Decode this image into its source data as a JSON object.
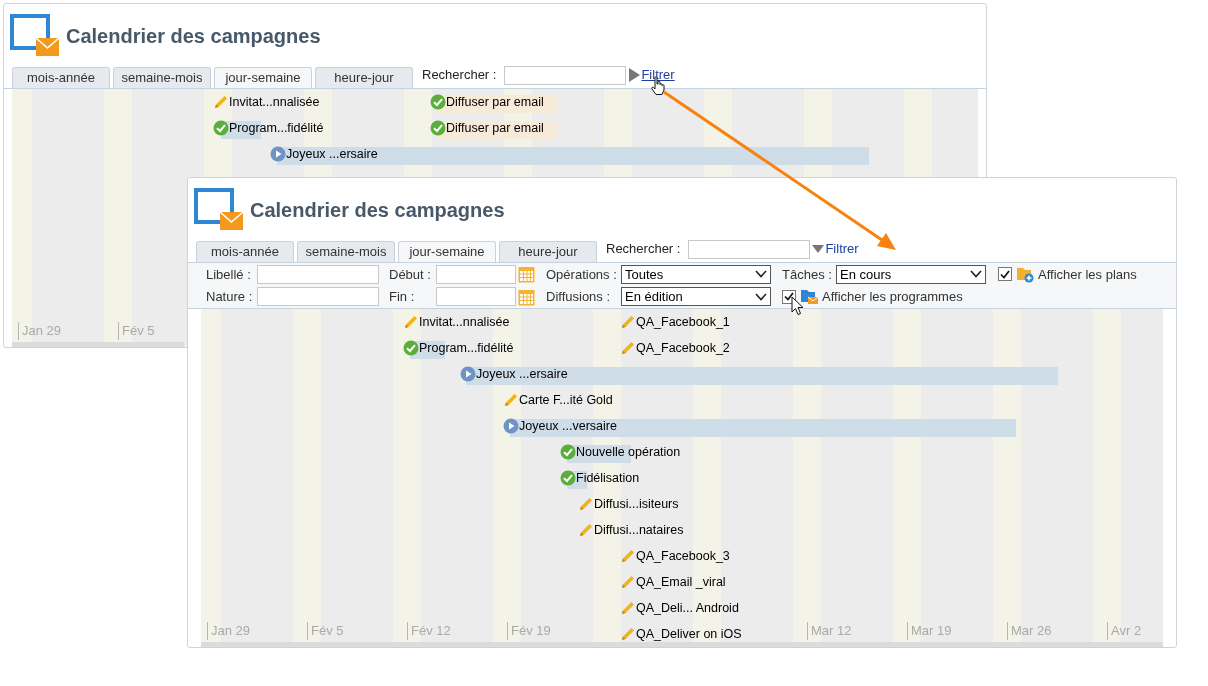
{
  "back_window": {
    "title": "Calendrier des campagnes",
    "tabs": [
      {
        "label": "mois-année",
        "selected": false
      },
      {
        "label": "semaine-mois",
        "selected": false
      },
      {
        "label": "jour-semaine",
        "selected": true
      },
      {
        "label": "heure-jour",
        "selected": false
      }
    ],
    "search_label": "Rechercher :",
    "filter_link": "Filtrer",
    "expanded": false,
    "rows": [
      [
        {
          "kind": "edit",
          "label": "Invitat...nnalisée"
        },
        {
          "kind": "done",
          "label": "Diffuser par email"
        }
      ],
      [
        {
          "kind": "done",
          "label": "Program...fidélité"
        },
        {
          "kind": "done",
          "label": "Diffuser par email"
        }
      ],
      [
        {
          "kind": "running",
          "label": "Joyeux ...ersaire"
        }
      ]
    ],
    "axis": [
      "Jan 29",
      "Fév 5"
    ]
  },
  "front_window": {
    "title": "Calendrier des campagnes",
    "tabs": [
      {
        "label": "mois-année",
        "selected": false
      },
      {
        "label": "semaine-mois",
        "selected": false
      },
      {
        "label": "jour-semaine",
        "selected": true
      },
      {
        "label": "heure-jour",
        "selected": false
      }
    ],
    "search_label": "Rechercher :",
    "filter_link": "Filtrer",
    "expanded": true,
    "filter_rows": [
      [
        {
          "kind": "text",
          "label": "Libellé :"
        },
        {
          "kind": "date",
          "label": "Début :"
        },
        {
          "kind": "select",
          "label": "Opérations :",
          "value": "Toutes"
        },
        {
          "kind": "select",
          "label": "Tâches :",
          "value": "En cours"
        },
        {
          "kind": "checkbox",
          "label": "Afficher les plans",
          "checked": true
        }
      ],
      [
        {
          "kind": "text",
          "label": "Nature :"
        },
        {
          "kind": "date",
          "label": "Fin :"
        },
        {
          "kind": "select",
          "label": "Diffusions :",
          "value": "En édition"
        },
        {
          "kind": "checkbox",
          "label": "Afficher les programmes",
          "checked": true
        }
      ]
    ],
    "rows": [
      [
        {
          "kind": "edit",
          "label": "Invitat...nnalisée"
        },
        {
          "kind": "edit",
          "label": "QA_Facebook_1"
        }
      ],
      [
        {
          "kind": "done",
          "label": "Program...fidélité"
        },
        {
          "kind": "edit",
          "label": "QA_Facebook_2"
        }
      ],
      [
        {
          "kind": "running",
          "label": "Joyeux ...ersaire"
        }
      ],
      [
        {
          "kind": "edit",
          "label": "Carte F...ité Gold"
        }
      ],
      [
        {
          "kind": "running",
          "label": "Joyeux ...versaire"
        }
      ],
      [
        {
          "kind": "done",
          "label": "Nouvelle opération"
        }
      ],
      [
        {
          "kind": "done",
          "label": "Fidélisation"
        }
      ],
      [
        {
          "kind": "edit",
          "label": "Diffusi...isiteurs"
        }
      ],
      [
        {
          "kind": "edit",
          "label": "Diffusi...nataires"
        }
      ],
      [
        {
          "kind": "edit",
          "label": "QA_Facebook_3"
        }
      ],
      [
        {
          "kind": "edit",
          "label": "QA_Email _viral"
        }
      ],
      [
        {
          "kind": "edit",
          "label": "QA_Deli... Android"
        }
      ],
      [
        {
          "kind": "edit",
          "label": "QA_Deliver on iOS"
        }
      ]
    ],
    "axis": [
      "Jan 29",
      "Fév 5",
      "Fév 12",
      "Fév 19",
      "Mar 12",
      "Mar 19",
      "Mar 26",
      "Avr 2"
    ]
  }
}
